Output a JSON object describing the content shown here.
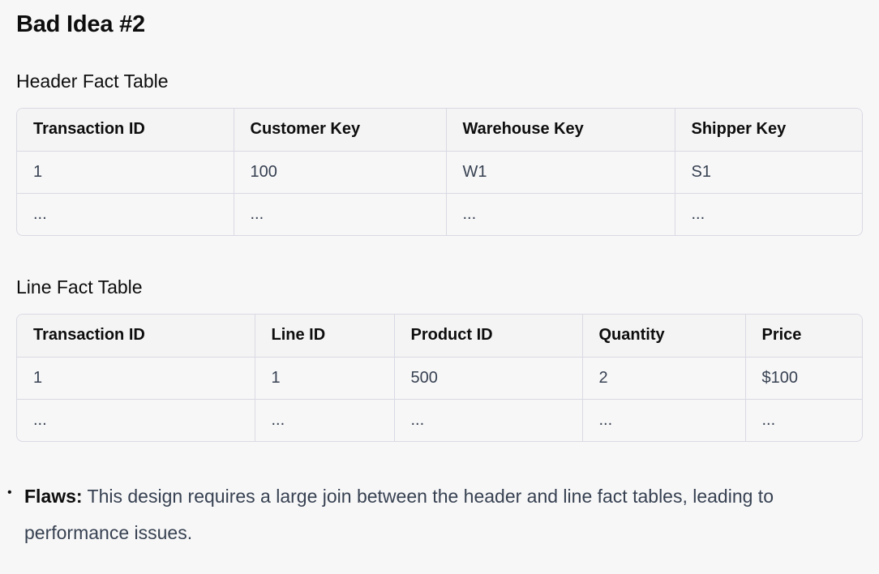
{
  "title": "Bad Idea #2",
  "header_table": {
    "heading": "Header Fact Table",
    "columns": [
      "Transaction ID",
      "Customer Key",
      "Warehouse Key",
      "Shipper Key"
    ],
    "rows": [
      [
        "1",
        "100",
        "W1",
        "S1"
      ],
      [
        "...",
        "...",
        "...",
        "..."
      ]
    ]
  },
  "line_table": {
    "heading": "Line Fact Table",
    "columns": [
      "Transaction ID",
      "Line ID",
      "Product ID",
      "Quantity",
      "Price"
    ],
    "rows": [
      [
        "1",
        "1",
        "500",
        "2",
        "$100"
      ],
      [
        "...",
        "...",
        "...",
        "...",
        "..."
      ]
    ]
  },
  "bullet": {
    "marker": "•",
    "label": "Flaws:",
    "text": " This design requires a large join between the header and line fact tables, leading to performance issues."
  }
}
